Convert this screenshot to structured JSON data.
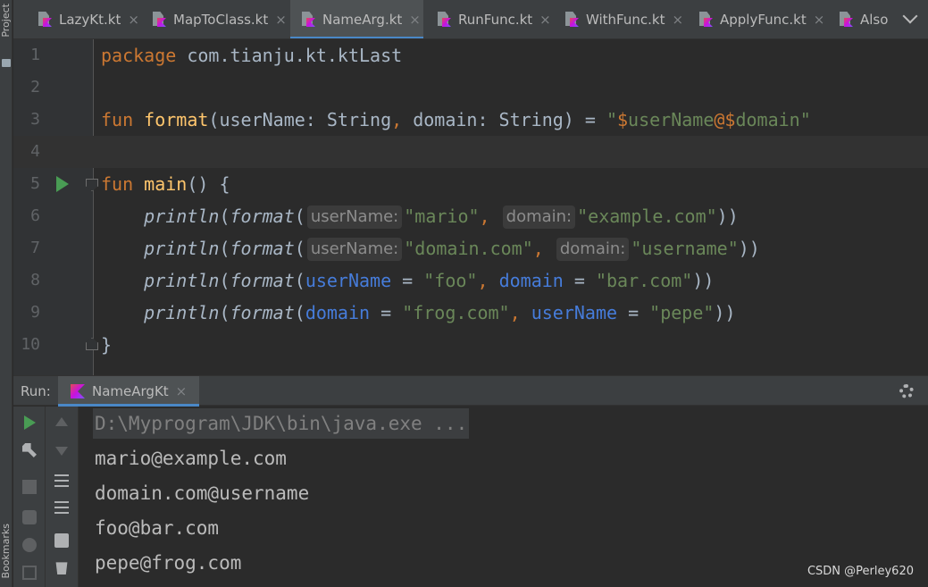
{
  "sidebar": {
    "project_label": "Project",
    "bookmarks_label": "Bookmarks"
  },
  "tabs": [
    {
      "label": "LazyKt.kt",
      "active": false
    },
    {
      "label": "MapToClass.kt",
      "active": false
    },
    {
      "label": "NameArg.kt",
      "active": true
    },
    {
      "label": "RunFunc.kt",
      "active": false
    },
    {
      "label": "WithFunc.kt",
      "active": false
    },
    {
      "label": "ApplyFunc.kt",
      "active": false
    },
    {
      "label": "Also",
      "active": false
    }
  ],
  "editor": {
    "line_numbers": [
      "1",
      "2",
      "3",
      "4",
      "5",
      "6",
      "7",
      "8",
      "9",
      "10"
    ],
    "line1": {
      "kw": "package",
      "pkg": " com.tianju.kt.ktLast"
    },
    "line3": {
      "kw": "fun",
      "name": "format",
      "params": "(userName: String",
      "comma": ",",
      "params2": " domain: String) = ",
      "q1": "\"",
      "d1": "$",
      "v1": "userName",
      "at": "@",
      "d2": "$",
      "v2": "domain",
      "q2": "\""
    },
    "line5": {
      "kw": "fun",
      "name": "main",
      "rest": "() {"
    },
    "line6": {
      "println": "println",
      "format": "format",
      "open": "(",
      "hint1": "userName:",
      "arg1": "\"mario\"",
      "comma": ",",
      "hint2": "domain:",
      "arg2": "\"example.com\"",
      "close": "))"
    },
    "line7": {
      "println": "println",
      "format": "format",
      "open": "(",
      "hint1": "userName:",
      "arg1": "\"domain.com\"",
      "comma": ",",
      "hint2": "domain:",
      "arg2": "\"username\"",
      "close": "))"
    },
    "line8": {
      "println": "println",
      "format": "format",
      "open": "(",
      "n1": "userName",
      "eq": " = ",
      "arg1": "\"foo\"",
      "comma": ",",
      "n2": "domain",
      "arg2": "\"bar.com\"",
      "close": "))"
    },
    "line9": {
      "println": "println",
      "format": "format",
      "open": "(",
      "n1": "domain",
      "eq": " = ",
      "arg1": "\"frog.com\"",
      "comma": ",",
      "n2": "userName",
      "arg2": "\"pepe\"",
      "close": "))"
    },
    "line10": {
      "text": "}"
    }
  },
  "run": {
    "label": "Run:",
    "tab_label": "NameArgKt",
    "console": [
      "D:\\Myprogram\\JDK\\bin\\java.exe ...",
      "mario@example.com",
      "domain.com@username",
      "foo@bar.com",
      "pepe@frog.com"
    ]
  },
  "watermark": "CSDN @Perley620",
  "colors": {
    "keyword": "#cc7832",
    "function": "#ffc66d",
    "string": "#6a8759",
    "named_arg": "#467cda",
    "accent": "#4a88c7",
    "run_green": "#499c54"
  }
}
